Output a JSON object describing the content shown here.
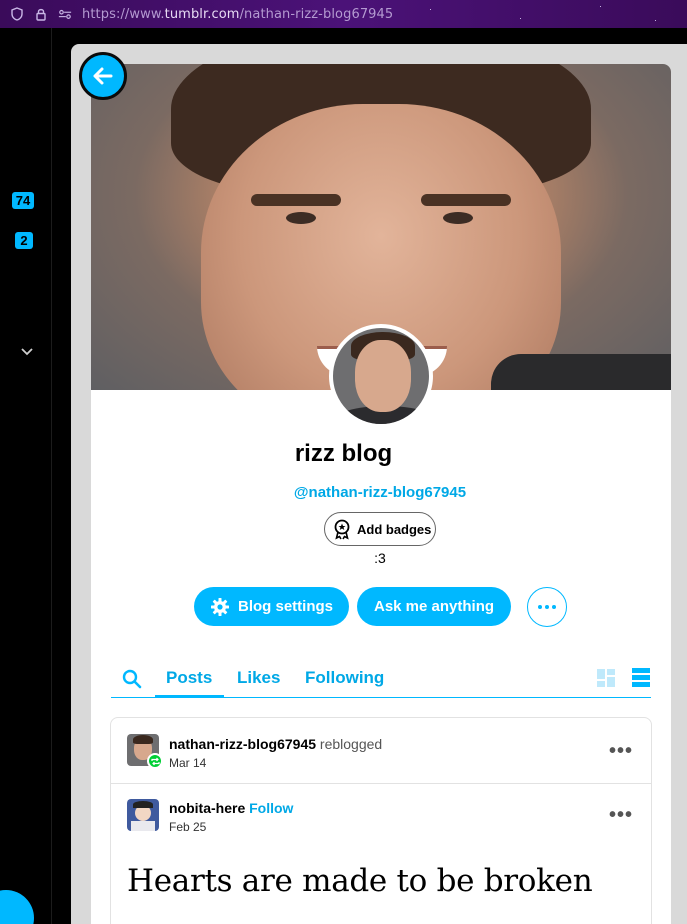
{
  "browser": {
    "url_prefix": "https://www.",
    "url_domain": "tumblr.com",
    "url_path": "/nathan-rizz-blog67945"
  },
  "sidebar": {
    "badge_count_1": "74",
    "badge_count_2": "2"
  },
  "blog": {
    "title": "rizz blog",
    "handle": "@nathan-rizz-blog67945",
    "add_badges_label": "Add badges",
    "description": ":3"
  },
  "actions": {
    "settings_label": "Blog settings",
    "ask_label": "Ask me anything"
  },
  "tabs": [
    {
      "label": "Posts"
    },
    {
      "label": "Likes"
    },
    {
      "label": "Following"
    }
  ],
  "post": {
    "reblogger_name": "nathan-rizz-blog67945",
    "reblog_word": "reblogged",
    "reblog_date": "Mar 14",
    "author_name": "nobita-here",
    "follow_label": "Follow",
    "author_date": "Feb 25",
    "headline": "Hearts are made to be broken"
  },
  "colors": {
    "accent": "#00b8ff",
    "link": "#00a8e6",
    "reblog_green": "#00cf35"
  }
}
